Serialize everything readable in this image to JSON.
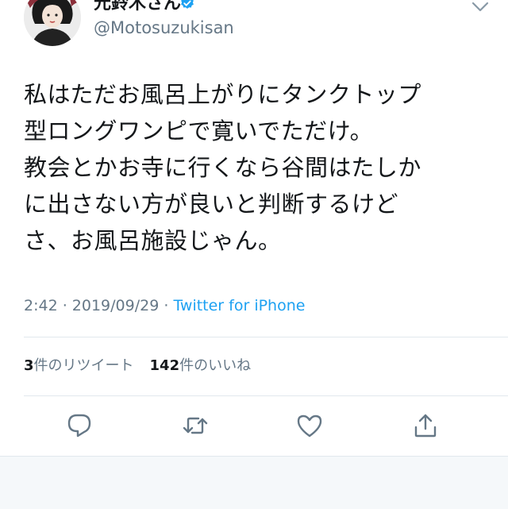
{
  "author": {
    "display_name": "元鈴木さん",
    "handle": "@Motosuzukisan",
    "avatar_icon": "avatar-illustration",
    "verified_icon": "verified-badge-icon"
  },
  "tweet": {
    "lines": [
      "私はただお風呂上がりにタンクトップ",
      "型ロングワンピで寛いでただけ。",
      "教会とかお寺に行くなら谷間はたしか",
      "に出さない方が良いと判断するけど",
      "さ、お風呂施設じゃん。"
    ]
  },
  "meta": {
    "time": "2:42",
    "separator1": " · ",
    "date": "2019/09/29",
    "separator2": " · ",
    "source": "Twitter for iPhone"
  },
  "stats": {
    "retweet_count": "3",
    "retweet_label": "件のリツイート",
    "like_count": "142",
    "like_label": "件のいいね"
  },
  "actions": {
    "reply_icon": "reply-icon",
    "retweet_icon": "retweet-icon",
    "like_icon": "heart-icon",
    "share_icon": "share-icon"
  },
  "colors": {
    "accent": "#1da1f2",
    "muted": "#657786",
    "text": "#14171a",
    "divider": "#e1e8ed"
  }
}
